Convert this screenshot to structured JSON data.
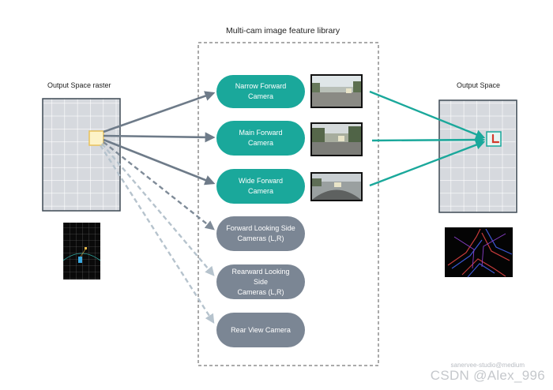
{
  "title": "Multi-cam image feature library",
  "left_label": "Output Space raster",
  "right_label": "Output Space",
  "cameras": [
    {
      "label": "Narrow Forward\nCamera",
      "active": true
    },
    {
      "label": "Main Forward Camera",
      "active": true
    },
    {
      "label": "Wide Forward Camera",
      "active": true
    },
    {
      "label": "Forward Looking Side\nCameras (L,R)",
      "active": false
    },
    {
      "label": "Rearward Looking Side\nCameras (L,R)",
      "active": false
    },
    {
      "label": "Rear View Camera",
      "active": false
    }
  ],
  "watermark_small": "sanervee-studio@medium",
  "watermark_large": "CSDN @Alex_996",
  "colors": {
    "teal": "#1aa89b",
    "gray_pill": "#7b8694",
    "solid_arrow": "#6e7b89",
    "dashed_dark": "#7f8b98",
    "dashed_light": "#b6c3cd",
    "grid_bg": "#d6d9de",
    "highlight_cell": "#fdf3c8",
    "highlight_border": "#e8c15a"
  }
}
